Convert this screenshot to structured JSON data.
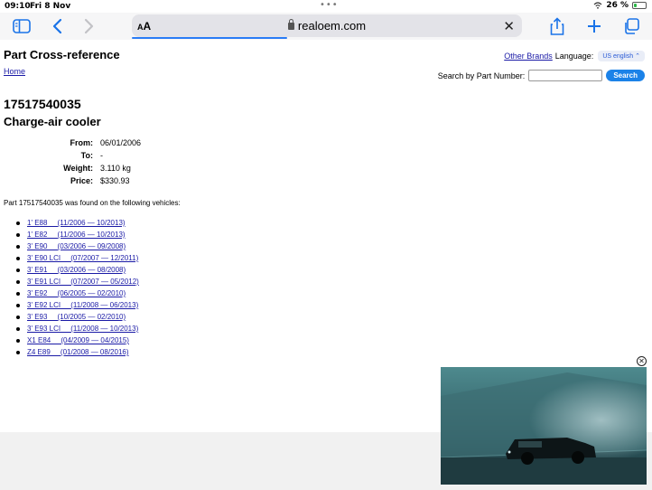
{
  "status_bar": {
    "time": "09:10",
    "date": "Fri 8 Nov",
    "battery": "26 %",
    "battery_fraction": 0.26
  },
  "toolbar": {
    "text_size_label": "AA",
    "url": "realoem.com"
  },
  "page": {
    "title": "Part Cross-reference",
    "home_link": "Home",
    "other_brands": "Other Brands",
    "language_label": "Language:",
    "language_value": "US english",
    "search_label": "Search by Part Number:",
    "search_value": "",
    "search_button": "Search",
    "part_number": "17517540035",
    "part_name": "Charge-air cooler",
    "specs": [
      {
        "key": "From:",
        "value": "06/01/2006"
      },
      {
        "key": "To:",
        "value": "-"
      },
      {
        "key": "Weight:",
        "value": "3.110 kg"
      },
      {
        "key": "Price:",
        "value": "$330.93"
      }
    ],
    "found_text": "Part 17517540035 was found on the following vehicles:",
    "vehicles": [
      "1' E88     (11/2006 — 10/2013)",
      "1' E82     (11/2006 — 10/2013)",
      "3' E90     (03/2006 — 09/2008)",
      "3' E90 LCI     (07/2007 — 12/2011)",
      "3' E91     (03/2006 — 08/2008)",
      "3' E91 LCI     (07/2007 — 05/2012)",
      "3' E92     (06/2005 — 02/2010)",
      "3' E92 LCI     (11/2008 — 06/2013)",
      "3' E93     (10/2005 — 02/2010)",
      "3' E93 LCI     (11/2008 — 10/2013)",
      "X1 E84     (04/2009 — 04/2015)",
      "Z4 E89     (01/2008 — 08/2016)"
    ]
  },
  "colors": {
    "link": "#1a1aa6",
    "accent": "#1b82e8",
    "toolbar_bg": "#f6f6f7"
  }
}
